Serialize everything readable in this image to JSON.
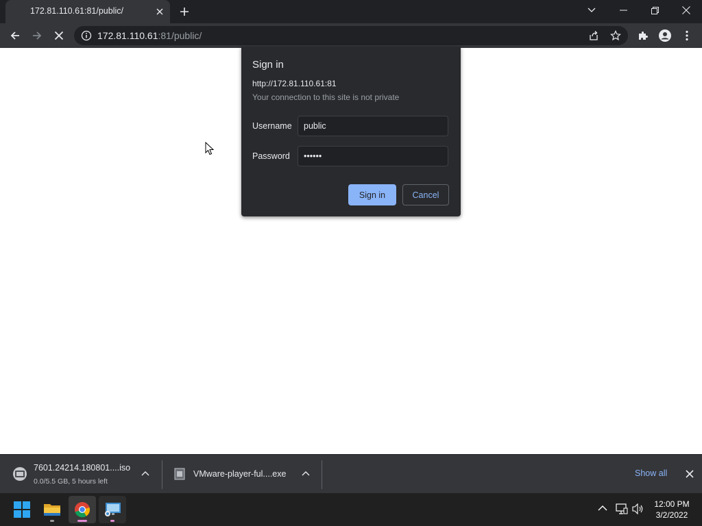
{
  "browser": {
    "tab": {
      "title": "172.81.110.61:81/public/"
    },
    "address": {
      "host": "172.81.110.61",
      "rest": ":81/public/"
    }
  },
  "dialog": {
    "title": "Sign in",
    "url": "http://172.81.110.61:81",
    "note": "Your connection to this site is not private",
    "username_label": "Username",
    "username_value": "public",
    "password_label": "Password",
    "password_value": "••••••",
    "signin_label": "Sign in",
    "cancel_label": "Cancel"
  },
  "downloads": {
    "items": [
      {
        "name": "7601.24214.180801....iso",
        "status": "0.0/5.5 GB, 5 hours left",
        "icon": "iso-file-icon"
      },
      {
        "name": "VMware-player-ful....exe",
        "status": "",
        "icon": "exe-file-icon"
      }
    ],
    "show_all": "Show all"
  },
  "taskbar": {
    "apps": [
      "windows-start-icon",
      "file-explorer-icon",
      "chrome-icon",
      "remote-desktop-icon"
    ],
    "time": "12:00 PM",
    "date": "3/2/2022"
  },
  "colors": {
    "accent": "#8ab4f8",
    "dialog_bg": "#292a2d",
    "toolbar_bg": "#35363a",
    "tabstrip_bg": "#202124"
  }
}
